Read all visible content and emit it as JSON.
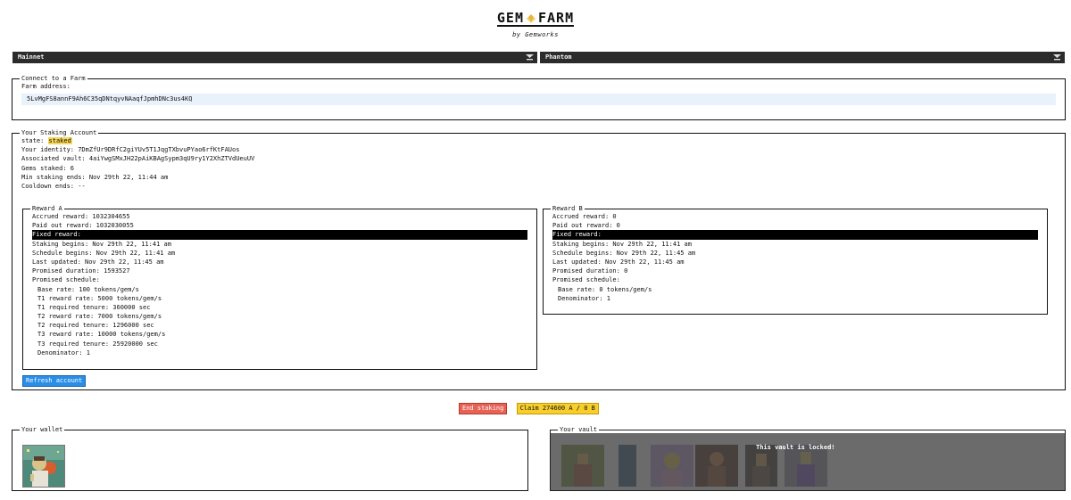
{
  "header": {
    "logo_left": "GEM",
    "logo_right": "FARM",
    "byline": "by Gemworks"
  },
  "selects": {
    "network": "Mainnet",
    "wallet": "Phantom"
  },
  "connect": {
    "legend": "Connect to a Farm",
    "farm_label": "Farm address:",
    "farm_address": "5LvMgFS8annF9Ah6C35qDNtqyvNAaqfJpmhDNc3us4KQ"
  },
  "staking": {
    "legend": "Your Staking Account",
    "state_label": "state:",
    "state_value": "staked",
    "identity": "Your identity: 7DmZfUr9DRfC2giYUv5T1JqgTXbvuPYao6rfKtFAUos",
    "vault": "Associated vault: 4aiYwgSMxJH22pAiKBAgSypm3qU9ry1Y2XhZTVdUeuUV",
    "gems": "Gems staked: 6",
    "min_ends": "Min staking ends: Nov 29th 22, 11:44 am",
    "cooldown": "Cooldown ends: --",
    "refresh_label": "Refresh account"
  },
  "reward_a": {
    "legend": "Reward A",
    "accrued": "Accrued reward: 1032304655",
    "paid": "Paid out reward: 1032030055",
    "fixed": "Fixed reward:",
    "staking_begins": "Staking begins: Nov 29th 22, 11:41 am",
    "schedule_begins": "Schedule begins: Nov 29th 22, 11:41 am",
    "last_updated": "Last updated: Nov 29th 22, 11:45 am",
    "duration": "Promised duration: 1593527",
    "schedule": "Promised schedule:",
    "base_rate": "Base rate: 100 tokens/gem/s",
    "t1_rate": "T1 reward rate: 5000 tokens/gem/s",
    "t1_tenure": "T1 required tenure: 360000 sec",
    "t2_rate": "T2 reward rate: 7000 tokens/gem/s",
    "t2_tenure": "T2 required tenure: 1296000 sec",
    "t3_rate": "T3 reward rate: 10000 tokens/gem/s",
    "t3_tenure": "T3 required tenure: 25920000 sec",
    "denominator": "Denominator: 1"
  },
  "reward_b": {
    "legend": "Reward B",
    "accrued": "Accrued reward: 0",
    "paid": "Paid out reward: 0",
    "fixed": "Fixed reward:",
    "staking_begins": "Staking begins: Nov 29th 22, 11:41 am",
    "schedule_begins": "Schedule begins: Nov 29th 22, 11:45 am",
    "last_updated": "Last updated: Nov 29th 22, 11:45 am",
    "duration": "Promised duration: 0",
    "schedule": "Promised schedule:",
    "base_rate": "Base rate: 0 tokens/gem/s",
    "denominator": "Denominator: 1"
  },
  "actions": {
    "end_label": "End staking",
    "claim_label": "Claim 274600 A / 0 B"
  },
  "wallet": {
    "legend": "Your wallet"
  },
  "vault": {
    "legend": "Your vault",
    "locked": "This vault is locked!"
  },
  "colors": {
    "accent_blue": "#2a8ee6",
    "danger_red": "#e56255",
    "claim_yellow": "#f7ce2b",
    "state_highlight": "#f7d659"
  }
}
